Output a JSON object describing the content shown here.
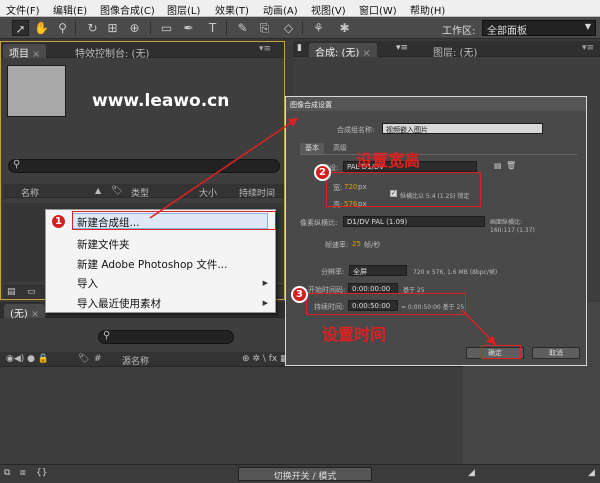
{
  "menubar": [
    "文件(F)",
    "编辑(E)",
    "图像合成(C)",
    "图层(L)",
    "效果(T)",
    "动画(A)",
    "视图(V)",
    "窗口(W)",
    "帮助(H)"
  ],
  "workspace": {
    "label": "工作区:",
    "value": "全部面板"
  },
  "left_panel": {
    "tab_project": "项目",
    "tab_effects": "特效控制台: (无)",
    "columns": [
      "名称",
      "类型",
      "大小",
      "持续时间"
    ]
  },
  "right_panel": {
    "tab_comp": "合成: (无)",
    "tab_layer": "图层: (无)"
  },
  "watermark": "www.leawo.cn",
  "context_menu": {
    "items": [
      "新建合成组...",
      "新建文件夹",
      "新建 Adobe Photoshop 文件...",
      "导入",
      "导入最近使用素材"
    ]
  },
  "timeline": {
    "tab": "(无)",
    "col_source": "源名称",
    "switch_label": "切换开关 / 模式"
  },
  "dialog": {
    "title": "图像合成设置",
    "name_label": "合成组名称:",
    "name_value": "视频嵌入图片",
    "tab_basic": "基本",
    "tab_advanced": "高级",
    "preset_label": "预设:",
    "preset_value": "PAL D1/DV",
    "width_label": "宽:",
    "width_value": "720",
    "height_label": "高:",
    "height_value": "576",
    "unit": "px",
    "lock_label": "纵横比以 5:4 (1.25) 锁定",
    "par_label": "像素纵横比:",
    "par_value": "D1/DV PAL (1.09)",
    "frame_aspect_label": "画面纵横比:",
    "frame_aspect_value": "160:117 (1.37)",
    "fps_label": "帧速率:",
    "fps_value": "25",
    "fps_unit": "帧/秒",
    "res_label": "分辨率:",
    "res_value": "全屏",
    "res_info": "720 x 576, 1.6 MB (8bpc/帧)",
    "start_label": "开始时间码:",
    "start_value": "0:00:00:00",
    "start_base": "基于 25",
    "dur_label": "持续时间:",
    "dur_value": "0:00:50:00",
    "dur_info": "= 0:00:50:00  基于 25",
    "ok": "确定",
    "cancel": "取消"
  },
  "annotations": {
    "badge1": "1",
    "badge2": "2",
    "badge3": "3",
    "set_size": "设置宽高",
    "set_time": "设置时间"
  },
  "colors": {
    "annotation_red": "#e02020",
    "highlight_orange": "#e0a000"
  }
}
